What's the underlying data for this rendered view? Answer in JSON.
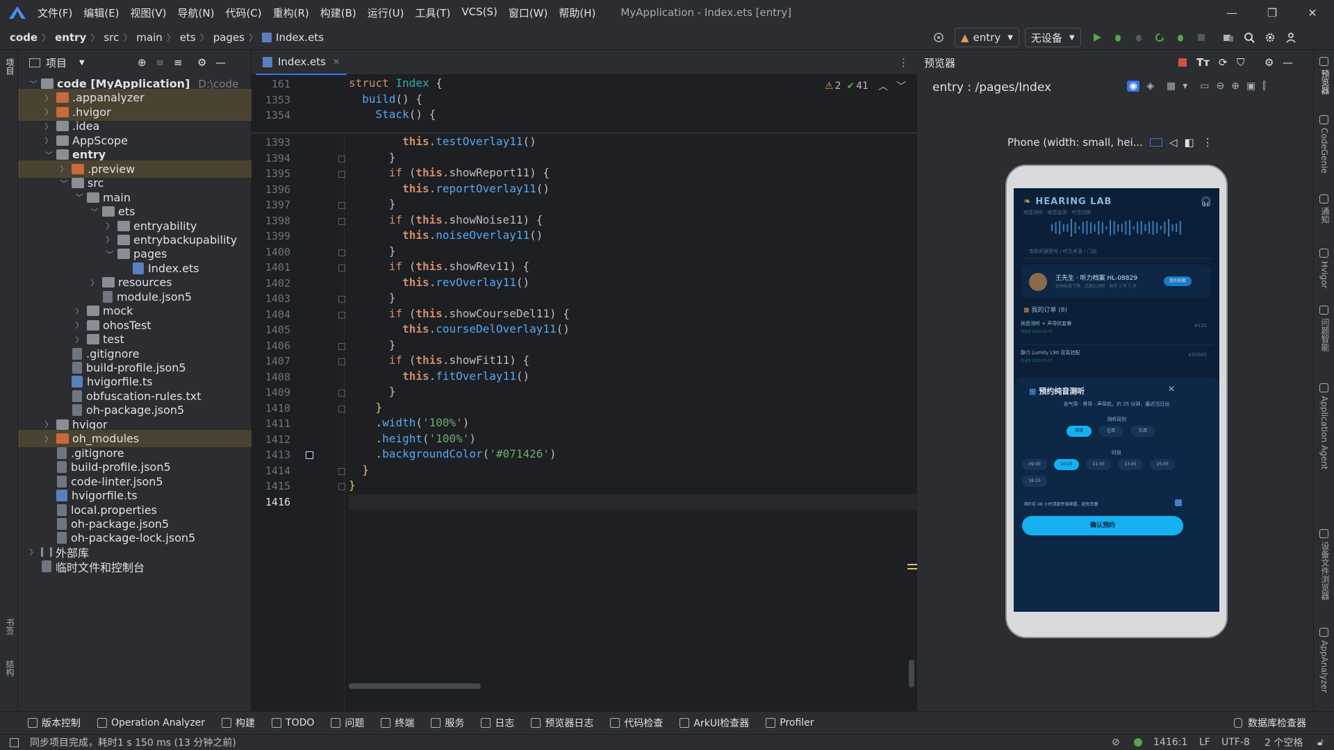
{
  "menubar": {
    "items": [
      "文件(F)",
      "编辑(E)",
      "视图(V)",
      "导航(N)",
      "代码(C)",
      "重构(R)",
      "构建(B)",
      "运行(U)",
      "工具(T)",
      "VCS(S)",
      "窗口(W)",
      "帮助(H)"
    ],
    "title": "MyApplication - Index.ets [entry]"
  },
  "breadcrumb": [
    "code",
    "entry",
    "src",
    "main",
    "ets",
    "pages",
    "Index.ets"
  ],
  "toolbar": {
    "module": "entry",
    "device": "无设备"
  },
  "project": {
    "header": "项目",
    "tree": [
      {
        "label": "code [MyApplication]",
        "hint": "D:\\code",
        "depth": 0,
        "open": true,
        "icon": "folder",
        "bold": true,
        "hl": false
      },
      {
        "label": ".appanalyzer",
        "depth": 1,
        "open": false,
        "icon": "folder-o",
        "hl": true
      },
      {
        "label": ".hvigor",
        "depth": 1,
        "open": false,
        "icon": "folder-o",
        "hl": true
      },
      {
        "label": ".idea",
        "depth": 1,
        "open": false,
        "icon": "folder"
      },
      {
        "label": "AppScope",
        "depth": 1,
        "open": false,
        "icon": "folder"
      },
      {
        "label": "entry",
        "depth": 1,
        "open": true,
        "icon": "folder",
        "bold": true
      },
      {
        "label": ".preview",
        "depth": 2,
        "open": false,
        "icon": "folder-o",
        "hl": true
      },
      {
        "label": "src",
        "depth": 2,
        "open": true,
        "icon": "folder"
      },
      {
        "label": "main",
        "depth": 3,
        "open": true,
        "icon": "folder"
      },
      {
        "label": "ets",
        "depth": 4,
        "open": true,
        "icon": "folder"
      },
      {
        "label": "entryability",
        "depth": 5,
        "open": false,
        "icon": "folder"
      },
      {
        "label": "entrybackupability",
        "depth": 5,
        "open": false,
        "icon": "folder"
      },
      {
        "label": "pages",
        "depth": 5,
        "open": true,
        "icon": "folder"
      },
      {
        "label": "Index.ets",
        "depth": 6,
        "leaf": true,
        "icon": "ets"
      },
      {
        "label": "resources",
        "depth": 4,
        "open": false,
        "icon": "folder"
      },
      {
        "label": "module.json5",
        "depth": 4,
        "leaf": true,
        "icon": "file"
      },
      {
        "label": "mock",
        "depth": 3,
        "open": false,
        "icon": "folder"
      },
      {
        "label": "ohosTest",
        "depth": 3,
        "open": false,
        "icon": "folder"
      },
      {
        "label": "test",
        "depth": 3,
        "open": false,
        "icon": "folder"
      },
      {
        "label": ".gitignore",
        "depth": 2,
        "leaf": true,
        "icon": "file"
      },
      {
        "label": "build-profile.json5",
        "depth": 2,
        "leaf": true,
        "icon": "file"
      },
      {
        "label": "hvigorfile.ts",
        "depth": 2,
        "leaf": true,
        "icon": "ets"
      },
      {
        "label": "obfuscation-rules.txt",
        "depth": 2,
        "leaf": true,
        "icon": "file"
      },
      {
        "label": "oh-package.json5",
        "depth": 2,
        "leaf": true,
        "icon": "file"
      },
      {
        "label": "hvigor",
        "depth": 1,
        "open": false,
        "icon": "folder"
      },
      {
        "label": "oh_modules",
        "depth": 1,
        "open": false,
        "icon": "folder-o",
        "hl": true
      },
      {
        "label": ".gitignore",
        "depth": 1,
        "leaf": true,
        "icon": "file"
      },
      {
        "label": "build-profile.json5",
        "depth": 1,
        "leaf": true,
        "icon": "file"
      },
      {
        "label": "code-linter.json5",
        "depth": 1,
        "leaf": true,
        "icon": "file"
      },
      {
        "label": "hvigorfile.ts",
        "depth": 1,
        "leaf": true,
        "icon": "ets"
      },
      {
        "label": "local.properties",
        "depth": 1,
        "leaf": true,
        "icon": "file"
      },
      {
        "label": "oh-package.json5",
        "depth": 1,
        "leaf": true,
        "icon": "file"
      },
      {
        "label": "oh-package-lock.json5",
        "depth": 1,
        "leaf": true,
        "icon": "file"
      },
      {
        "label": "外部库",
        "depth": 0,
        "open": false,
        "icon": "lib"
      },
      {
        "label": "临时文件和控制台",
        "depth": 0,
        "leaf": true,
        "icon": "file"
      }
    ]
  },
  "editor": {
    "tab": "Index.ets",
    "warnings": "2",
    "checks": "41",
    "sticky": [
      {
        "n": "161",
        "html": "<span class=\"kw\">struct</span> <span class=\"tp\">Index</span> {"
      },
      {
        "n": "1353",
        "html": "  <span class=\"fn\">build</span>() {"
      },
      {
        "n": "1354",
        "html": "    <span class=\"fn\">Stack</span>() {"
      }
    ],
    "lines": [
      {
        "n": "1393",
        "html": "        <span class=\"th\">this</span>.<span class=\"fn\">testOverlay11</span>()"
      },
      {
        "n": "1394",
        "html": "      }",
        "fold": true
      },
      {
        "n": "1395",
        "html": "      <span class=\"kw\">if</span> (<span class=\"th\">this</span>.showReport11) {",
        "fold": true
      },
      {
        "n": "1396",
        "html": "        <span class=\"th\">this</span>.<span class=\"fn\">reportOverlay11</span>()"
      },
      {
        "n": "1397",
        "html": "      }",
        "fold": true
      },
      {
        "n": "1398",
        "html": "      <span class=\"kw\">if</span> (<span class=\"th\">this</span>.showNoise11) {",
        "fold": true
      },
      {
        "n": "1399",
        "html": "        <span class=\"th\">this</span>.<span class=\"fn\">noiseOverlay11</span>()"
      },
      {
        "n": "1400",
        "html": "      }",
        "fold": true
      },
      {
        "n": "1401",
        "html": "      <span class=\"kw\">if</span> (<span class=\"th\">this</span>.showRev11) {",
        "fold": true
      },
      {
        "n": "1402",
        "html": "        <span class=\"th\">this</span>.<span class=\"fn\">revOverlay11</span>()"
      },
      {
        "n": "1403",
        "html": "      }",
        "fold": true
      },
      {
        "n": "1404",
        "html": "      <span class=\"kw\">if</span> (<span class=\"th\">this</span>.showCourseDel11) {",
        "fold": true
      },
      {
        "n": "1405",
        "html": "        <span class=\"th\">this</span>.<span class=\"fn\">courseDelOverlay11</span>()"
      },
      {
        "n": "1406",
        "html": "      }",
        "fold": true
      },
      {
        "n": "1407",
        "html": "      <span class=\"kw\">if</span> (<span class=\"th\">this</span>.showFit11) {",
        "fold": true
      },
      {
        "n": "1408",
        "html": "        <span class=\"th\">this</span>.<span class=\"fn\">fitOverlay11</span>()"
      },
      {
        "n": "1409",
        "html": "      }",
        "fold": true
      },
      {
        "n": "1410",
        "html": "    <span class=\"br\">}</span>",
        "fold": true
      },
      {
        "n": "1411",
        "html": "    .<span class=\"fn\">width</span>(<span class=\"st\">'100%'</span>)"
      },
      {
        "n": "1412",
        "html": "    .<span class=\"fn\">height</span>(<span class=\"st\">'100%'</span>)"
      },
      {
        "n": "1413",
        "html": "    .<span class=\"fn\">backgroundColor</span>(<span class=\"st\">'#071426'</span>)",
        "swatch": true
      },
      {
        "n": "1414",
        "html": "  <span class=\"br\">}</span>",
        "fold": true
      },
      {
        "n": "1415",
        "html": "<span class=\"br\">}</span>",
        "fold": true
      },
      {
        "n": "1416",
        "html": ""
      }
    ]
  },
  "preview": {
    "header": "预览器",
    "route": "entry : /pages/Index",
    "device": "Phone (width: small, hei...",
    "app": {
      "brand": "HEARING LAB",
      "brand_sub": "纯音测听 · 噪音监测 · 听觉训练",
      "search_hint": "查助听器型号 / 听力术语 / 门店",
      "user": "王先生 · 听力档案 HL-08829",
      "user_sub": "右侧轻度下降 · 近期已测听 · 助听 3 年 5 月",
      "user_badge": "我的档案",
      "orders_title": "我的订单 (8)",
      "order1": "纯音测听 + 声导抗套餐",
      "order1_status": "待完成  2026-03-20",
      "order1_price": "¥120",
      "order2": "静力 Lumity L90 双耳验配",
      "order2_status": "验试中  2026-03-15",
      "order2_price": "¥32800",
      "modal_title": "预约纯音测听",
      "modal_desc": "含气导 · 骨导 · 声导抗，约 25 分钟，最迟当日出",
      "ear_label": "测听耳别",
      "ears": [
        "双耳",
        "左耳",
        "右耳"
      ],
      "time_label": "时段",
      "times": [
        "09:00",
        "10:15",
        "11:30",
        "13:45",
        "15:00",
        "16:15"
      ],
      "notice": "测听前 48 小时请避免强噪露，避免耳塞",
      "confirm": "确认预约"
    }
  },
  "right_strip": [
    "预览器",
    "CodeGenie",
    "通知",
    "Hvigor",
    "问题智能",
    "Application Agent",
    "设备文件浏览器",
    "AppAnalyzer"
  ],
  "left_strip": [
    "项目",
    "书签",
    "结构"
  ],
  "bottom": [
    "版本控制",
    "Operation Analyzer",
    "构建",
    "TODO",
    "问题",
    "终端",
    "服务",
    "日志",
    "预览器日志",
    "代码检查",
    "ArkUI检查器",
    "Profiler"
  ],
  "bottom_right": "数据库检查器",
  "status": {
    "message": "同步项目完成，耗时1 s 150 ms (13 分钟之前)",
    "position": "1416:1",
    "eol": "LF",
    "encoding": "UTF-8",
    "indent": "2 个空格"
  }
}
